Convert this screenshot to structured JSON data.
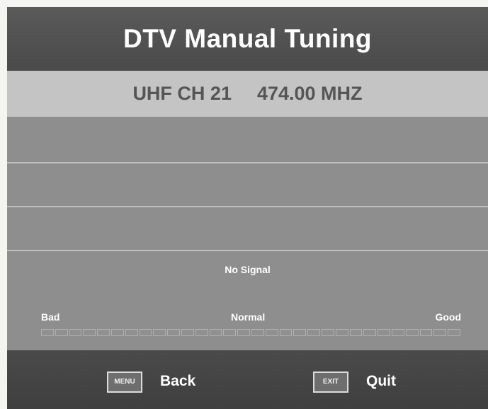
{
  "title": "DTV Manual Tuning",
  "channel": {
    "band_channel": "UHF CH 21",
    "frequency": "474.00 MHZ"
  },
  "signal": {
    "status": "No Signal",
    "scale": {
      "bad": "Bad",
      "normal": "Normal",
      "good": "Good"
    },
    "level_fraction": 0,
    "segment_count": 30
  },
  "footer": {
    "menu_key": "MENU",
    "menu_action": "Back",
    "exit_key": "EXIT",
    "exit_action": "Quit"
  },
  "colors": {
    "title_bar": "#4f4f4f",
    "channel_bar": "#c4c4c4",
    "body": "#8e8e8e",
    "text_light": "#ffffff"
  }
}
